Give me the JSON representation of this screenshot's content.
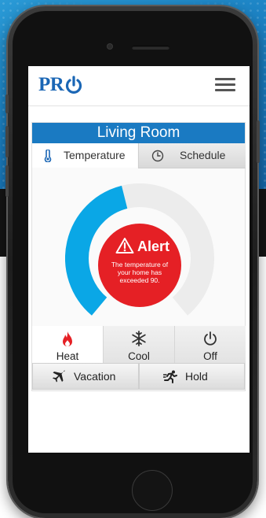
{
  "app": {
    "logo_text": "PR",
    "logo_icon": "power-icon"
  },
  "header": {
    "menu_icon": "hamburger-menu-icon"
  },
  "room": {
    "title": "Living Room"
  },
  "tabs": [
    {
      "label": "Temperature",
      "icon": "thermometer-icon",
      "active": true
    },
    {
      "label": "Schedule",
      "icon": "clock-icon",
      "active": false
    }
  ],
  "gauge": {
    "level": 0.45,
    "fill_color": "#0aa7e6",
    "track_color": "#ececec"
  },
  "alert": {
    "title": "Alert",
    "message": "The temperature of your home has exceeded 90.",
    "color": "#e52025",
    "icon": "warning-icon"
  },
  "modes": [
    {
      "label": "Heat",
      "icon": "flame-icon",
      "active": true
    },
    {
      "label": "Cool",
      "icon": "snowflake-icon",
      "active": false
    },
    {
      "label": "Off",
      "icon": "power-icon",
      "active": false
    }
  ],
  "actions": [
    {
      "label": "Vacation",
      "icon": "airplane-icon"
    },
    {
      "label": "Hold",
      "icon": "running-person-icon"
    }
  ],
  "colors": {
    "brand": "#1a66b5",
    "title_bar": "#1a7ac2",
    "heat": "#e52025"
  }
}
